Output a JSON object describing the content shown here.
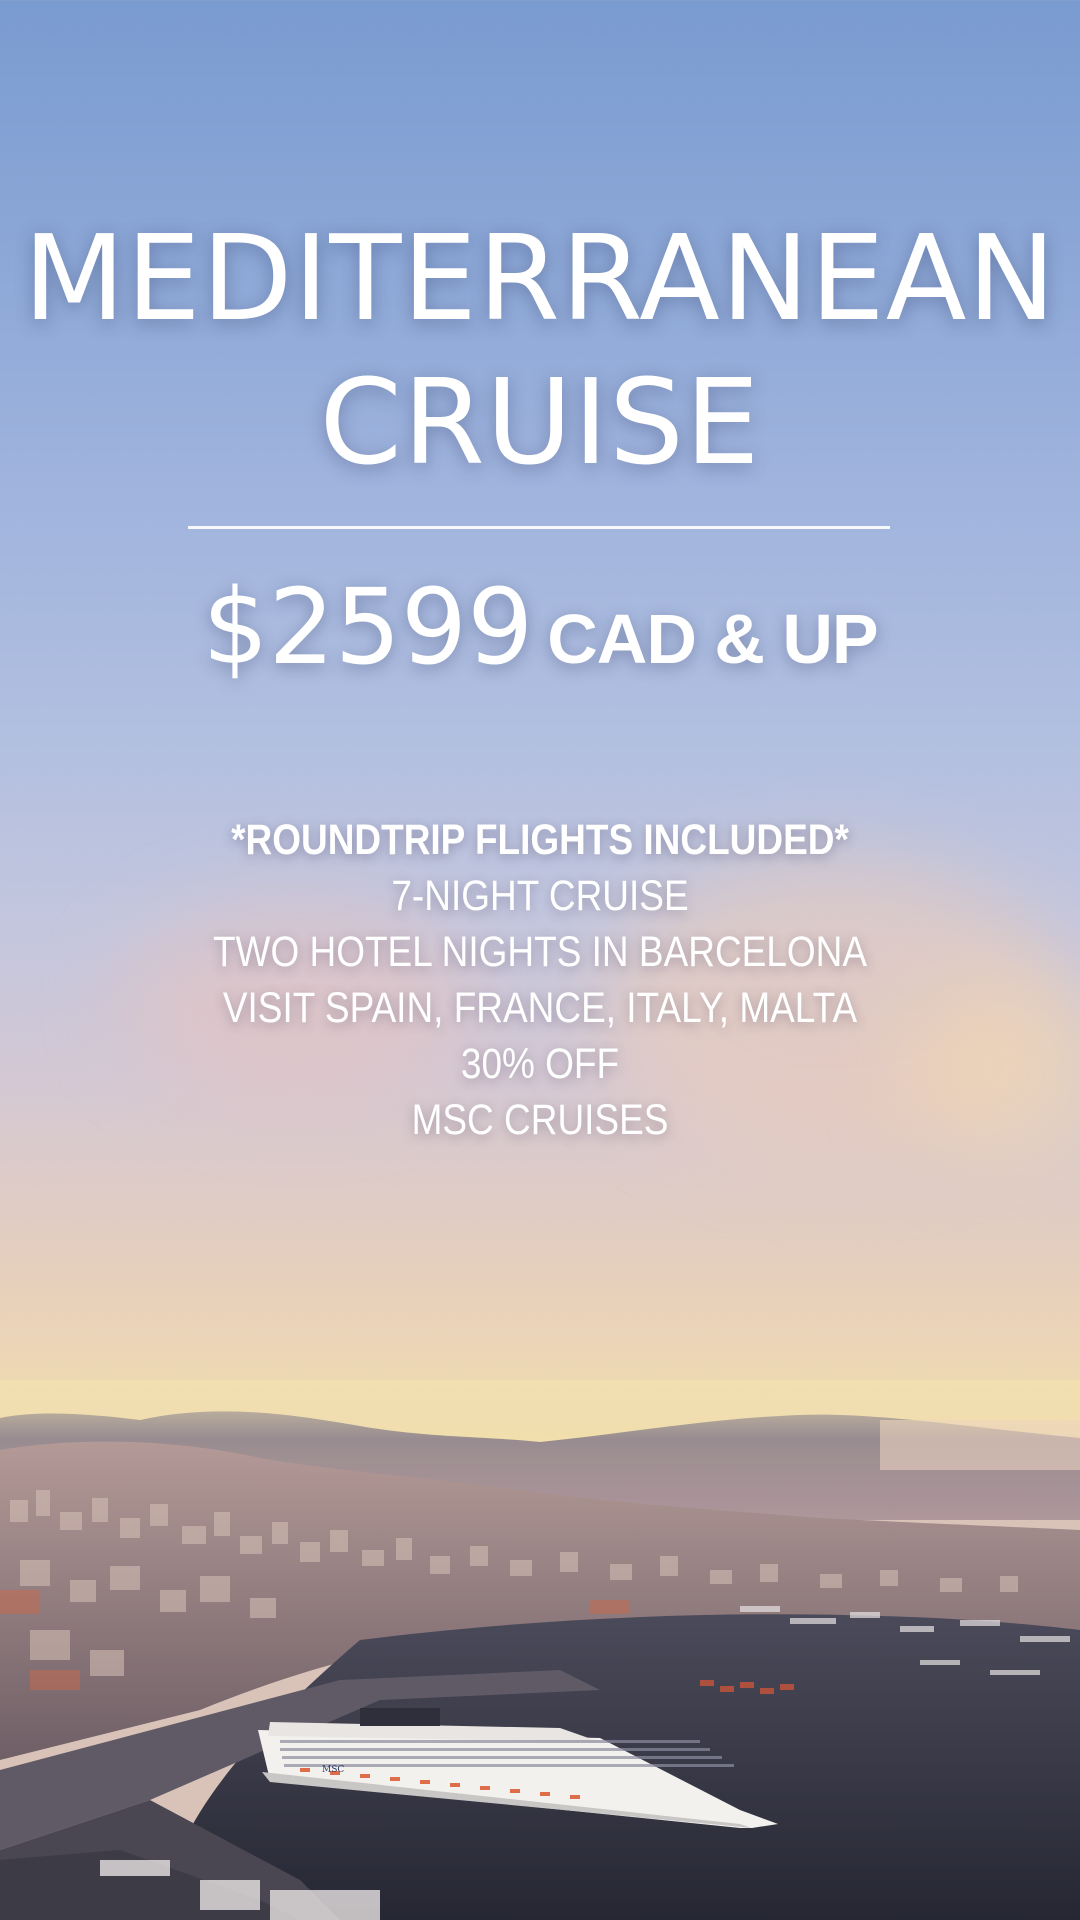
{
  "title": {
    "line1": "MEDITERRANEAN",
    "line2": "CRUISE"
  },
  "price": {
    "amount": "$2599",
    "suffix": "CAD & UP"
  },
  "features": {
    "headline": "*ROUNDTRIP FLIGHTS INCLUDED*",
    "items": [
      "7-NIGHT CRUISE",
      "TWO HOTEL NIGHTS IN BARCELONA",
      "VISIT SPAIN, FRANCE, ITALY, MALTA",
      "30% OFF",
      "MSC CRUISES"
    ]
  },
  "background": {
    "sky_top": "#7a9bd0",
    "sky_horizon": "#f3e2a8",
    "sea": "#2a2c3a"
  },
  "ship_logo": "MSC"
}
